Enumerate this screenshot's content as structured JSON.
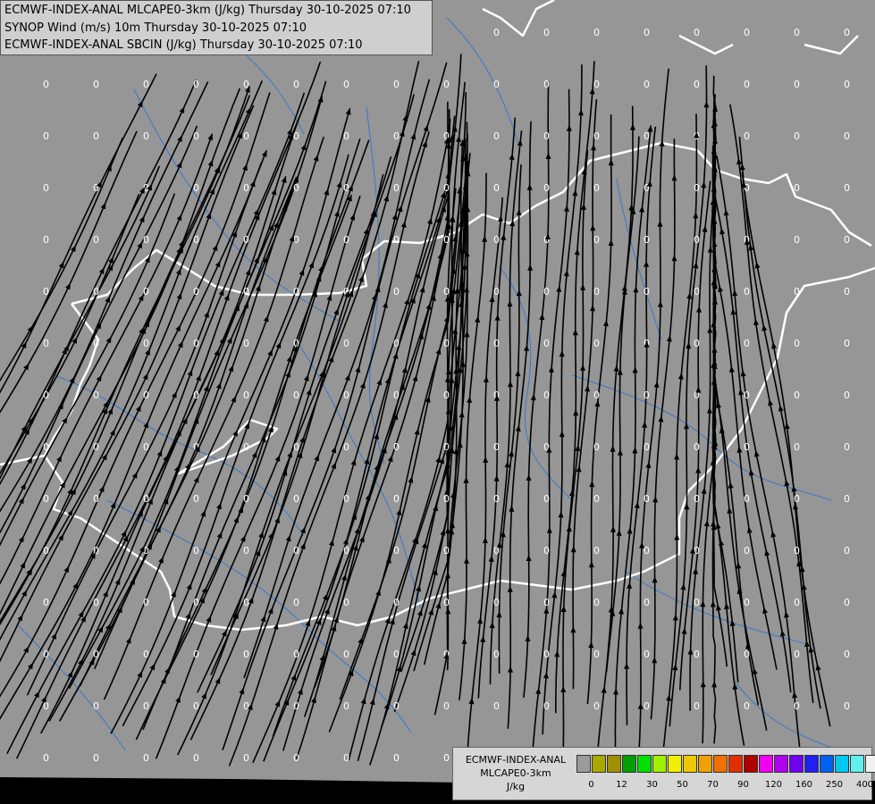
{
  "title_lines": [
    "ECMWF-INDEX-ANAL MLCAPE0-3km (J/kg) Thursday 30-10-2025 07:10",
    "SYNOP Wind (m/s) 10m Thursday 30-10-2025 07:10",
    "ECMWF-INDEX-ANAL SBCIN (J/kg) Thursday 30-10-2025 07:10"
  ],
  "legend": {
    "title": "ECMWF-INDEX-ANAL",
    "subtitle": "MLCAPE0-3km",
    "unit": "J/kg",
    "colors": [
      "#9a9a9a",
      "#a8a800",
      "#a09000",
      "#00a000",
      "#00e000",
      "#a0f000",
      "#f0f000",
      "#f0c800",
      "#f0a000",
      "#f07000",
      "#e03000",
      "#b00000",
      "#f000f0",
      "#b000f0",
      "#7000f0",
      "#2020f0",
      "#0060f0",
      "#00c8f0",
      "#60f0f0",
      "#f0f0f0"
    ],
    "ticks": [
      {
        "label": "0",
        "index": 1
      },
      {
        "label": "12",
        "index": 3
      },
      {
        "label": "30",
        "index": 5
      },
      {
        "label": "50",
        "index": 7
      },
      {
        "label": "70",
        "index": 9
      },
      {
        "label": "90",
        "index": 11
      },
      {
        "label": "120",
        "index": 13
      },
      {
        "label": "160",
        "index": 15
      },
      {
        "label": "250",
        "index": 17
      },
      {
        "label": "400",
        "index": 19
      }
    ]
  },
  "map": {
    "background": "#969696",
    "border_color": "#ffffff",
    "river_color": "#3a78c8",
    "streamline_color": "#000000",
    "value_label": "0",
    "value_color": "#ffffff"
  }
}
